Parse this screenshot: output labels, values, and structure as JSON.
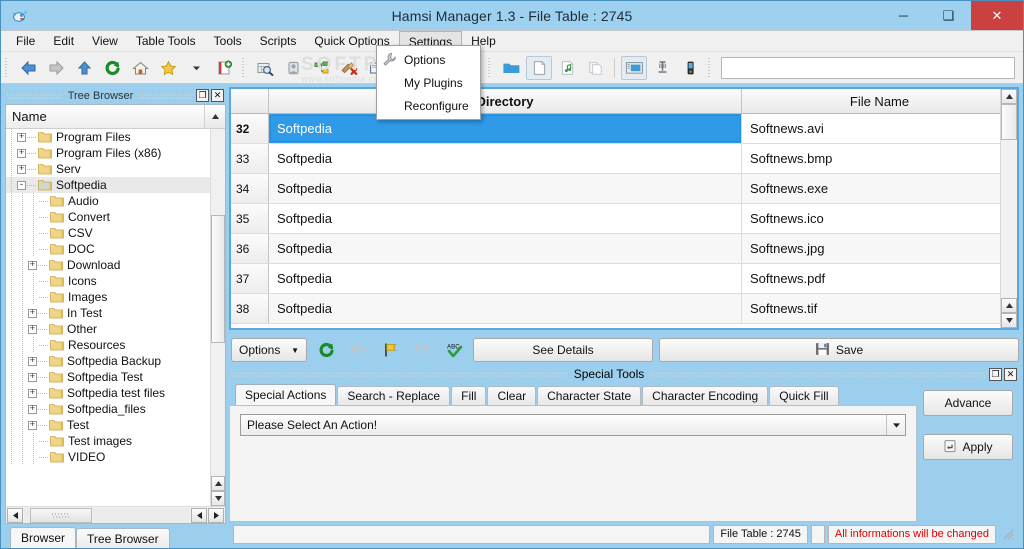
{
  "window": {
    "title": "Hamsi Manager 1.3 - File Table : 2745",
    "icon": "app-icon",
    "controls": {
      "minimize": "─",
      "maximize": "❑",
      "close": "✕"
    }
  },
  "menubar": {
    "items": [
      {
        "label": "File",
        "active": false
      },
      {
        "label": "Edit",
        "active": false
      },
      {
        "label": "View",
        "active": false
      },
      {
        "label": "Table Tools",
        "active": false
      },
      {
        "label": "Tools",
        "active": false
      },
      {
        "label": "Scripts",
        "active": false
      },
      {
        "label": "Quick Options",
        "active": false
      },
      {
        "label": "Settings",
        "active": true
      },
      {
        "label": "Help",
        "active": false
      }
    ]
  },
  "dropdown": {
    "open_menu": "Settings",
    "items": [
      {
        "label": "Options",
        "icon": "wrench-icon"
      },
      {
        "label": "My Plugins",
        "icon": ""
      },
      {
        "label": "Reconfigure",
        "icon": ""
      }
    ]
  },
  "toolbar": {
    "groups": [
      [
        "back-icon",
        "forward-icon",
        "up-icon",
        "refresh-icon",
        "home-icon",
        "star-icon",
        "chevron-down-icon",
        "new-document-icon"
      ],
      [
        "search-table-icon",
        "info-icon",
        "tree-icon",
        "clean-icon",
        "book-icon",
        "delete-doc-icon"
      ],
      [
        "folder-icon",
        "file-icon",
        "music-file-icon",
        "copy-icon",
        "screen-icon",
        "column-icon",
        "device-icon"
      ]
    ],
    "search_value": "",
    "search_placeholder": ""
  },
  "watermark": {
    "text": "SOFTPEDIA",
    "sub": "www.softpedia.com"
  },
  "tree_browser": {
    "panel_title": "Tree Browser",
    "column_header": "Name",
    "float_button": "❐",
    "close_button": "✕",
    "items": [
      {
        "label": "Program Files",
        "depth": 1,
        "expander": "+",
        "selected": false
      },
      {
        "label": "Program Files (x86)",
        "depth": 1,
        "expander": "+",
        "selected": false
      },
      {
        "label": "Serv",
        "depth": 1,
        "expander": "+",
        "selected": false
      },
      {
        "label": "Softpedia",
        "depth": 1,
        "expander": "-",
        "selected": true
      },
      {
        "label": "Audio",
        "depth": 2,
        "expander": "",
        "selected": false
      },
      {
        "label": "Convert",
        "depth": 2,
        "expander": "",
        "selected": false
      },
      {
        "label": "CSV",
        "depth": 2,
        "expander": "",
        "selected": false
      },
      {
        "label": "DOC",
        "depth": 2,
        "expander": "",
        "selected": false
      },
      {
        "label": "Download",
        "depth": 2,
        "expander": "+",
        "selected": false
      },
      {
        "label": "Icons",
        "depth": 2,
        "expander": "",
        "selected": false
      },
      {
        "label": "Images",
        "depth": 2,
        "expander": "",
        "selected": false
      },
      {
        "label": "In Test",
        "depth": 2,
        "expander": "+",
        "selected": false
      },
      {
        "label": "Other",
        "depth": 2,
        "expander": "+",
        "selected": false
      },
      {
        "label": "Resources",
        "depth": 2,
        "expander": "",
        "selected": false
      },
      {
        "label": "Softpedia Backup",
        "depth": 2,
        "expander": "+",
        "selected": false
      },
      {
        "label": "Softpedia Test",
        "depth": 2,
        "expander": "+",
        "selected": false
      },
      {
        "label": "Softpedia test files",
        "depth": 2,
        "expander": "+",
        "selected": false
      },
      {
        "label": "Softpedia_files",
        "depth": 2,
        "expander": "+",
        "selected": false
      },
      {
        "label": "Test",
        "depth": 2,
        "expander": "+",
        "selected": false
      },
      {
        "label": "Test images",
        "depth": 2,
        "expander": "",
        "selected": false
      },
      {
        "label": "VIDEO",
        "depth": 2,
        "expander": "",
        "selected": false
      }
    ],
    "bottom_tabs": [
      {
        "label": "Browser",
        "active": true
      },
      {
        "label": "Tree Browser",
        "active": false
      }
    ]
  },
  "file_table": {
    "columns": [
      "",
      "Directory",
      "File Name"
    ],
    "rows": [
      {
        "index": "32",
        "directory": "Softpedia",
        "filename": "Softnews.avi",
        "selected": true
      },
      {
        "index": "33",
        "directory": "Softpedia",
        "filename": "Softnews.bmp",
        "selected": false
      },
      {
        "index": "34",
        "directory": "Softpedia",
        "filename": "Softnews.exe",
        "selected": false
      },
      {
        "index": "35",
        "directory": "Softpedia",
        "filename": "Softnews.ico",
        "selected": false
      },
      {
        "index": "36",
        "directory": "Softpedia",
        "filename": "Softnews.jpg",
        "selected": false
      },
      {
        "index": "37",
        "directory": "Softpedia",
        "filename": "Softnews.pdf",
        "selected": false
      },
      {
        "index": "38",
        "directory": "Softpedia",
        "filename": "Softnews.tif",
        "selected": false
      }
    ],
    "selection_color": "#2e9ae8",
    "border_color": "#5ba7dd"
  },
  "action_bar": {
    "options_label": "Options",
    "options_arrow": "▼",
    "icons": [
      "refresh-icon",
      "undo-icon",
      "flag-icon",
      "redo-icon",
      "spellcheck-icon"
    ],
    "see_details_label": "See Details",
    "save_label": "Save",
    "save_icon": "floppy-icon"
  },
  "special_tools": {
    "panel_title": "Special Tools",
    "float_button": "❐",
    "close_button": "✕",
    "tabs": [
      {
        "label": "Special Actions",
        "active": true
      },
      {
        "label": "Search - Replace",
        "active": false
      },
      {
        "label": "Fill",
        "active": false
      },
      {
        "label": "Clear",
        "active": false
      },
      {
        "label": "Character State",
        "active": false
      },
      {
        "label": "Character Encoding",
        "active": false
      },
      {
        "label": "Quick Fill",
        "active": false
      }
    ],
    "action_select_value": "Please Select An Action!",
    "advance_label": "Advance",
    "apply_label": "Apply",
    "apply_icon": "apply-icon"
  },
  "status_bar": {
    "left_field": "",
    "file_table": "File Table : 2745",
    "spacer": "",
    "warning": "All informations will be changed",
    "warning_color": "#e00000"
  }
}
